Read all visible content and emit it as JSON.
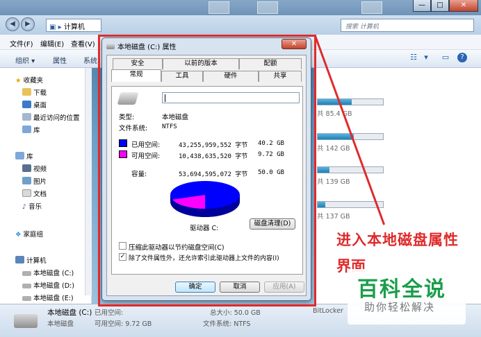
{
  "explorer": {
    "window_buttons": [
      "—",
      "□",
      "✕"
    ],
    "address": "计算机",
    "search_placeholder": "搜索 计算机",
    "menu": [
      "文件(F)",
      "编辑(E)",
      "查看(V)"
    ],
    "toolbar": [
      "组织 ▾",
      "属性",
      "系统"
    ],
    "sidebar": {
      "favorites_header": "收藏夹",
      "favorites": [
        "下载",
        "桌面",
        "最近访问的位置",
        "库"
      ],
      "libraries_header": "库",
      "libraries": [
        "视频",
        "图片",
        "文档",
        "音乐"
      ],
      "homegroup": "家庭组",
      "computer_header": "计算机",
      "drives": [
        "本地磁盘 (C:)",
        "本地磁盘 (D:)",
        "本地磁盘 (E:)"
      ]
    },
    "drives_free": [
      {
        "text": "共 85.4 GB",
        "fill": 0.52
      },
      {
        "text": "共 142 GB",
        "fill": 0.55
      },
      {
        "text": "共 139 GB",
        "fill": 0.18
      },
      {
        "text": "共 137 GB",
        "fill": 0.12
      }
    ],
    "status": {
      "name": "本地磁盘 (C:)",
      "type": "本地磁盘",
      "used_label": "已用空间:",
      "free_label": "可用空间: 9.72 GB",
      "total": "总大小: 50.0 GB",
      "fs": "文件系统: NTFS",
      "bitlocker": "BitLocker"
    }
  },
  "dialog": {
    "title": "本地磁盘 (C:) 属性",
    "close": "✕",
    "tabs_row1": [
      "安全",
      "以前的版本",
      "配额"
    ],
    "tabs_row2": [
      "常规",
      "工具",
      "硬件",
      "共享"
    ],
    "type_label": "类型:",
    "type_value": "本地磁盘",
    "fs_label": "文件系统:",
    "fs_value": "NTFS",
    "used_label": "已用空间:",
    "used_bytes": "43,255,959,552 字节",
    "used_gb": "40.2 GB",
    "free_label": "可用空间:",
    "free_bytes": "10,438,635,520 字节",
    "free_gb": "9.72 GB",
    "cap_label": "容量:",
    "cap_bytes": "53,694,595,072 字节",
    "cap_gb": "50.0 GB",
    "drive_label": "驱动器 C:",
    "cleanup": "磁盘清理(D)",
    "compress": "压缩此驱动器以节约磁盘空间(C)",
    "index": "除了文件属性外，还允许索引此驱动器上文件的内容(I)",
    "ok": "确定",
    "cancel": "取消",
    "apply": "应用(A)",
    "colors": {
      "used": "#0000ff",
      "free": "#ff00ff"
    },
    "used_fraction": 0.806
  },
  "annotation": {
    "line1": "进入本地磁盘属性",
    "line2": "界面"
  },
  "watermark": {
    "main": "百科全说",
    "sub": "助你轻松解决"
  }
}
